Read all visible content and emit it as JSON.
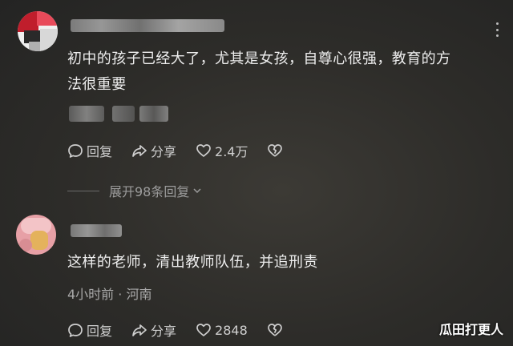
{
  "comments": [
    {
      "content": "初中的孩子已经大了，尤其是女孩，自尊心很强，教育的方\n法很重要",
      "actions": {
        "reply_label": "回复",
        "share_label": "分享",
        "like_count": "2.4万"
      },
      "expand_label": "展开98条回复"
    },
    {
      "content": "这样的老师，清出教师队伍，并追刑责",
      "meta": "4小时前 · 河南",
      "actions": {
        "reply_label": "回复",
        "share_label": "分享",
        "like_count": "2848"
      }
    }
  ],
  "icons": {
    "reply": "reply-bubble-icon",
    "share": "share-arrow-icon",
    "like": "heart-icon",
    "dislike": "broken-heart-icon",
    "expand": "chevron-down-icon",
    "more": "more-vertical-icon"
  },
  "watermark": "瓜田打更人"
}
